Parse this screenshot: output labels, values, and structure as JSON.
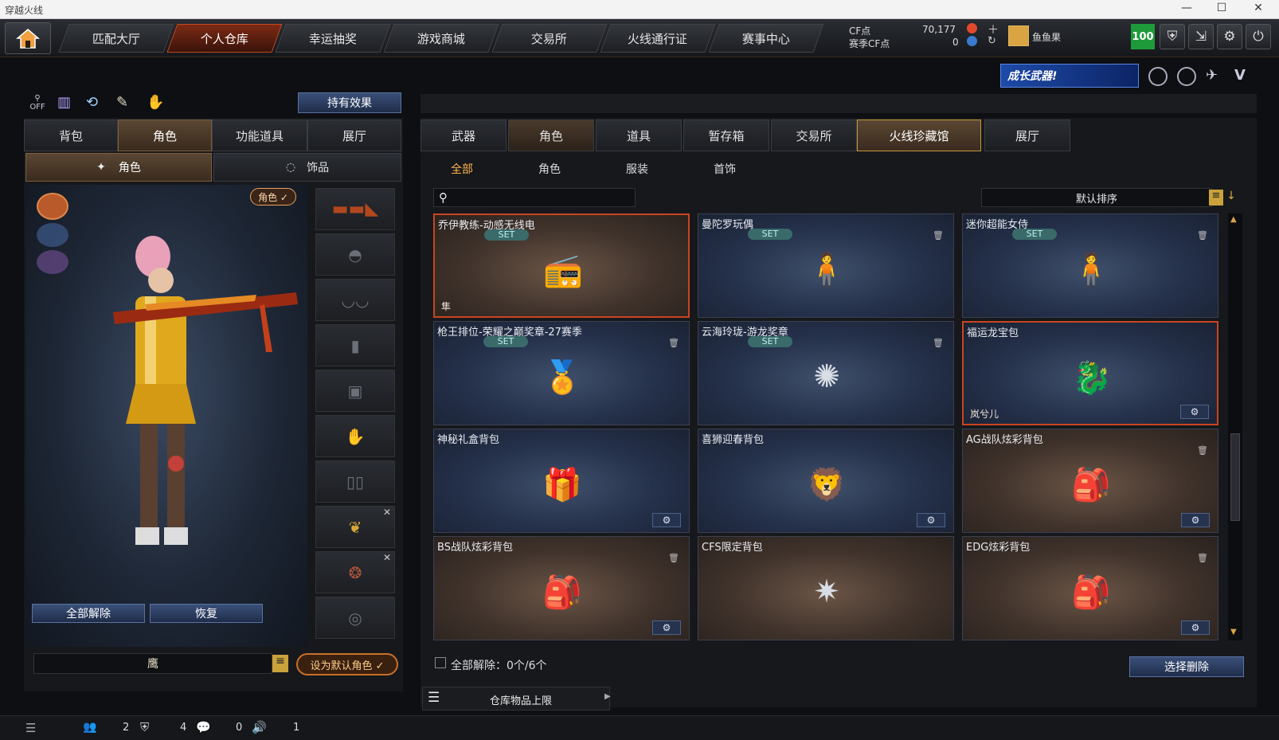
{
  "window": {
    "title": "穿越火线",
    "controls": [
      "—",
      "☐",
      "✕"
    ]
  },
  "topnav": {
    "tabs": [
      "匹配大厅",
      "个人仓库",
      "幸运抽奖",
      "游戏商城",
      "交易所",
      "火线通行证",
      "赛事中心"
    ],
    "active_tab": "个人仓库",
    "cf_label": "CF点",
    "cf_value": "70,177",
    "season_cf_label": "赛季CF点",
    "season_cf_value": "0",
    "username": "鱼鱼果",
    "level_badge": "100"
  },
  "banner": {
    "text": "成长武器!"
  },
  "left": {
    "hold_effect_button": "持有效果",
    "off_label": "OFF",
    "tabs": [
      "背包",
      "角色",
      "功能道具",
      "展厅"
    ],
    "active_tab": "角色",
    "subtabs": [
      "角色",
      "饰品"
    ],
    "role_tag": "角色 ✓",
    "unequip_all": "全部解除",
    "restore": "恢复",
    "character_name": "鹰",
    "set_default": "设为默认角色 ✓"
  },
  "right": {
    "tabs": [
      "武器",
      "角色",
      "道具",
      "暂存箱",
      "交易所",
      "火线珍藏馆",
      "展厅"
    ],
    "active_tab": "火线珍藏馆",
    "filters": [
      "全部",
      "角色",
      "服装",
      "首饰"
    ],
    "active_filter": "全部",
    "search_placeholder": "",
    "sort_label": "默认排序",
    "items": [
      {
        "name": "乔伊教练-动感无线电",
        "set": "SET",
        "tone": "brown",
        "selected": true,
        "tag": "隼",
        "trash": false,
        "gear": false,
        "icon": "walkie-talkie-icon"
      },
      {
        "name": "曼陀罗玩偶",
        "set": "SET",
        "tone": "blue",
        "selected": false,
        "tag": "",
        "trash": true,
        "gear": false,
        "icon": "doll-icon"
      },
      {
        "name": "迷你超能女侍",
        "set": "SET",
        "tone": "blue",
        "selected": false,
        "tag": "",
        "trash": true,
        "gear": false,
        "icon": "mini-figure-icon"
      },
      {
        "name": "枪王排位-荣耀之巅奖章-27赛季",
        "set": "SET",
        "tone": "blue",
        "selected": false,
        "tag": "",
        "trash": true,
        "gear": false,
        "icon": "medal-icon"
      },
      {
        "name": "云海玲珑-游龙奖章",
        "set": "SET",
        "tone": "blue",
        "selected": false,
        "tag": "",
        "trash": true,
        "gear": false,
        "icon": "pendant-icon"
      },
      {
        "name": "福运龙宝包",
        "set": "",
        "tone": "blue",
        "selected": true,
        "tag": "岚兮儿",
        "trash": false,
        "gear": true,
        "icon": "dragon-bag-icon"
      },
      {
        "name": "神秘礼盒背包",
        "set": "",
        "tone": "blue",
        "selected": false,
        "tag": "",
        "trash": false,
        "gear": true,
        "icon": "gift-box-icon"
      },
      {
        "name": "喜狮迎春背包",
        "set": "",
        "tone": "blue",
        "selected": false,
        "tag": "",
        "trash": false,
        "gear": true,
        "icon": "lion-head-icon"
      },
      {
        "name": "AG战队炫彩背包",
        "set": "",
        "tone": "brown",
        "selected": false,
        "tag": "",
        "trash": true,
        "gear": true,
        "icon": "ag-backpack-icon"
      },
      {
        "name": "BS战队炫彩背包",
        "set": "",
        "tone": "brown",
        "selected": false,
        "tag": "",
        "trash": true,
        "gear": true,
        "icon": "bs-backpack-icon"
      },
      {
        "name": "CFS限定背包",
        "set": "",
        "tone": "brown",
        "selected": false,
        "tag": "",
        "trash": false,
        "gear": false,
        "icon": "star-emblem-icon"
      },
      {
        "name": "EDG炫彩背包",
        "set": "",
        "tone": "brown",
        "selected": false,
        "tag": "",
        "trash": true,
        "gear": true,
        "icon": "edg-backpack-icon"
      }
    ],
    "unequip_summary": "全部解除：0个/6个",
    "select_delete": "选择删除",
    "storage_limit": "仓库物品上限"
  },
  "statusbar": {
    "friends": "2",
    "clan": "4",
    "messages": "0",
    "volume": "1"
  }
}
